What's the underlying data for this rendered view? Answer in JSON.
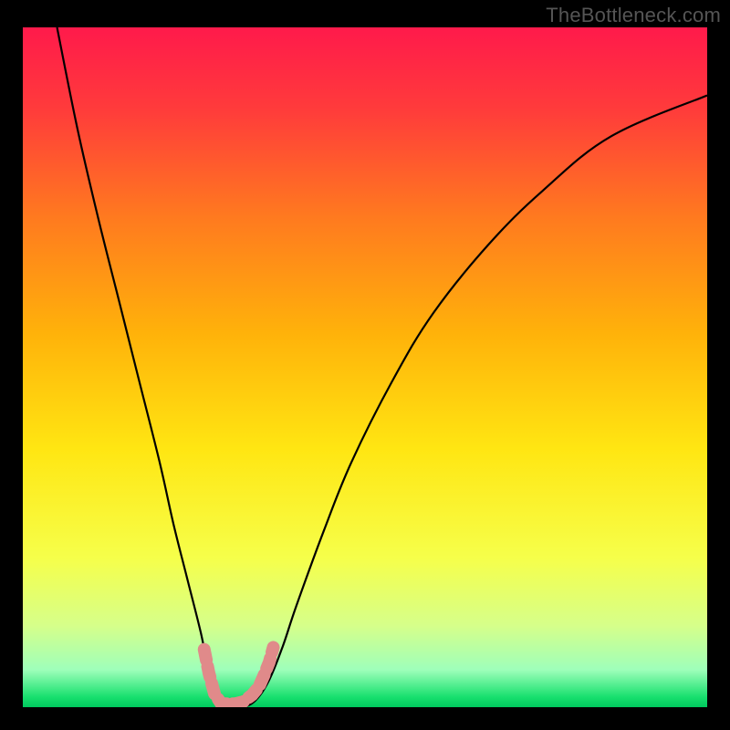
{
  "watermark": "TheBottleneck.com",
  "chart_data": {
    "type": "line",
    "title": "",
    "xlabel": "",
    "ylabel": "",
    "xlim": [
      0,
      100
    ],
    "ylim": [
      0,
      100
    ],
    "background_gradient": {
      "stops": [
        {
          "offset": 0.0,
          "color": "#ff1a4b"
        },
        {
          "offset": 0.12,
          "color": "#ff3b3b"
        },
        {
          "offset": 0.28,
          "color": "#ff7a1f"
        },
        {
          "offset": 0.45,
          "color": "#ffb20a"
        },
        {
          "offset": 0.62,
          "color": "#ffe612"
        },
        {
          "offset": 0.78,
          "color": "#f6ff4a"
        },
        {
          "offset": 0.88,
          "color": "#d6ff8a"
        },
        {
          "offset": 0.945,
          "color": "#9effba"
        },
        {
          "offset": 0.985,
          "color": "#18e06e"
        },
        {
          "offset": 1.0,
          "color": "#00c95e"
        }
      ]
    },
    "series": [
      {
        "name": "bottleneck-curve",
        "color": "#000000",
        "x": [
          5,
          8,
          11,
          14,
          17,
          20,
          22,
          24,
          26,
          27,
          28,
          29,
          30,
          32,
          34,
          36,
          38,
          40,
          44,
          48,
          54,
          60,
          68,
          76,
          86,
          100
        ],
        "y": [
          100,
          85,
          72,
          60,
          48,
          36,
          27,
          19,
          11,
          6,
          2,
          0,
          0,
          0,
          1,
          4,
          9,
          15,
          26,
          36,
          48,
          58,
          68,
          76,
          84,
          90
        ]
      },
      {
        "name": "optimal-zone-markers",
        "color": "#e08a8a",
        "type": "scatter",
        "x": [
          26.5,
          27.2,
          28.0,
          29.0,
          30.0,
          31.0,
          32.2,
          33.5,
          34.5,
          35.2,
          36.0,
          36.6
        ],
        "y": [
          8.5,
          5.0,
          2.0,
          0.5,
          0.5,
          0.5,
          0.8,
          1.8,
          3.0,
          4.6,
          6.6,
          8.8
        ]
      }
    ]
  }
}
